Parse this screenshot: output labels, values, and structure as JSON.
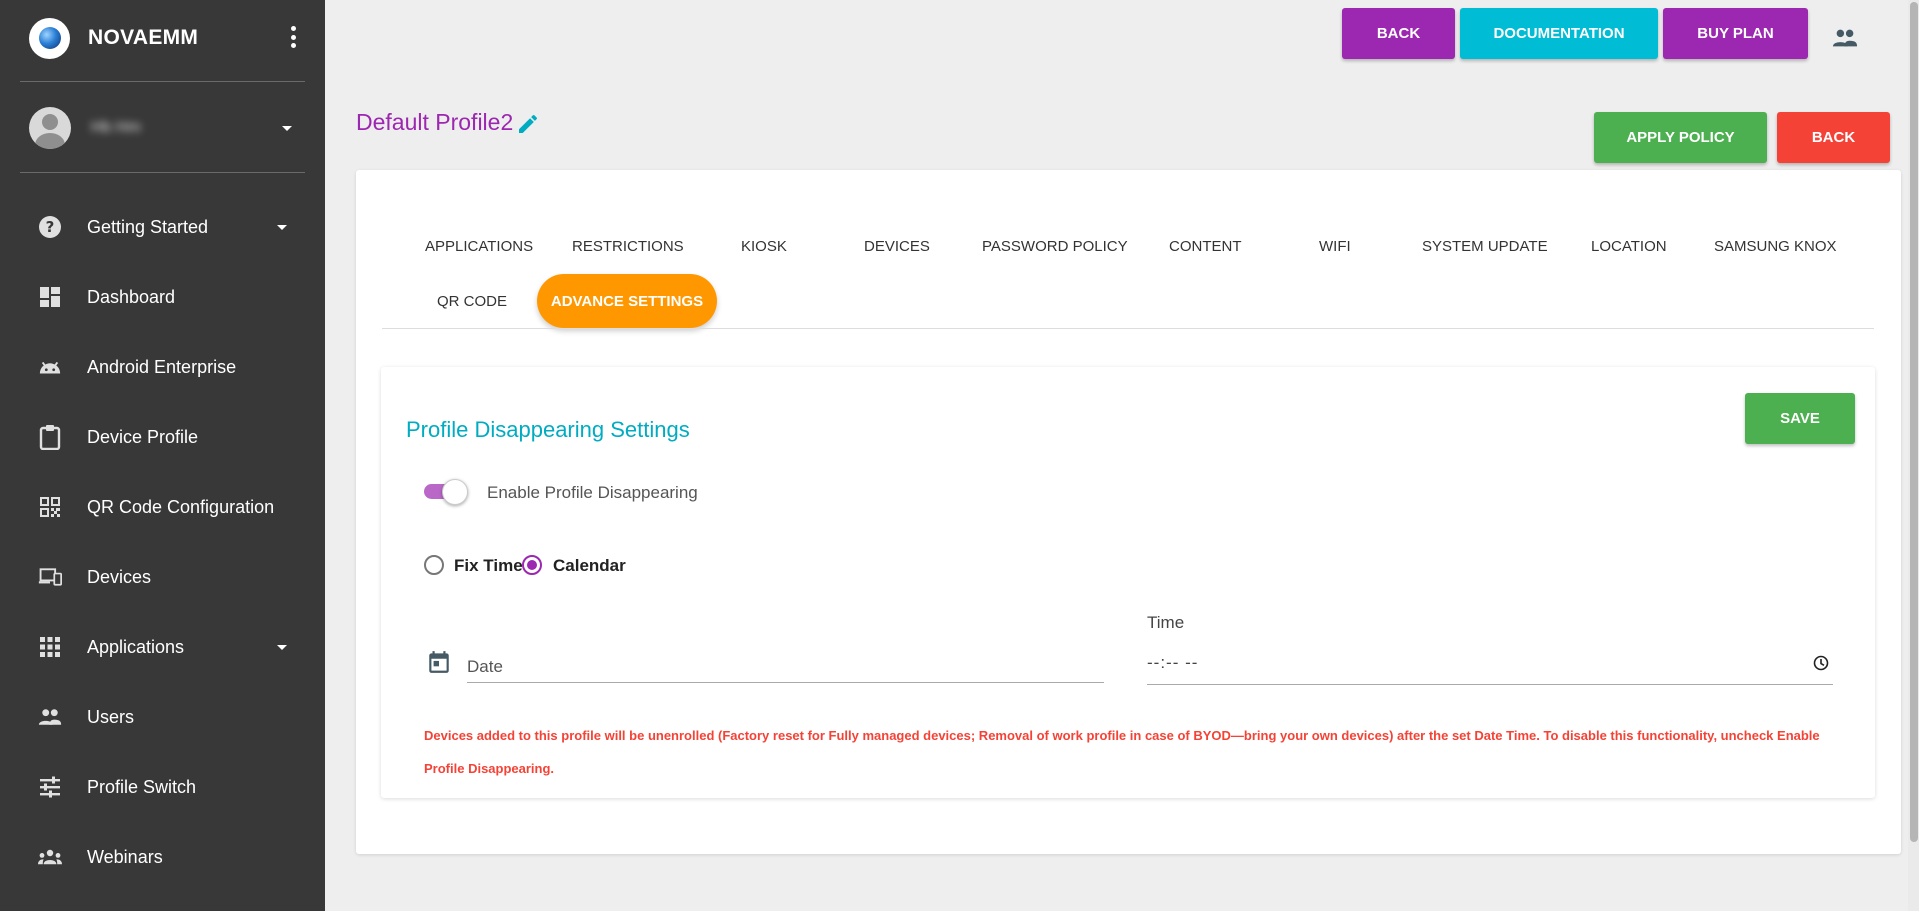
{
  "sidebar": {
    "brand": "NOVAEMM",
    "user_name": "Hb Hm",
    "items": [
      {
        "label": "Getting Started",
        "icon": "help-circle-icon",
        "has_caret": true
      },
      {
        "label": "Dashboard",
        "icon": "dashboard-icon",
        "has_caret": false
      },
      {
        "label": "Android Enterprise",
        "icon": "android-icon",
        "has_caret": false
      },
      {
        "label": "Device Profile",
        "icon": "clipboard-icon",
        "has_caret": false
      },
      {
        "label": "QR Code Configuration",
        "icon": "qr-code-icon",
        "has_caret": false
      },
      {
        "label": "Devices",
        "icon": "devices-icon",
        "has_caret": false
      },
      {
        "label": "Applications",
        "icon": "apps-grid-icon",
        "has_caret": true
      },
      {
        "label": "Users",
        "icon": "people-icon",
        "has_caret": false
      },
      {
        "label": "Profile Switch",
        "icon": "tune-icon",
        "has_caret": false
      },
      {
        "label": "Webinars",
        "icon": "groups-icon",
        "has_caret": false
      }
    ]
  },
  "header": {
    "back_label": "BACK",
    "documentation_label": "DOCUMENTATION",
    "buy_plan_label": "BUY PLAN"
  },
  "profile": {
    "title": "Default Profile2",
    "apply_policy_label": "APPLY POLICY",
    "back_label": "BACK"
  },
  "tabs": [
    "APPLICATIONS",
    "RESTRICTIONS",
    "KIOSK",
    "DEVICES",
    "PASSWORD POLICY",
    "CONTENT",
    "WIFI",
    "SYSTEM UPDATE",
    "LOCATION",
    "SAMSUNG KNOX",
    "QR CODE",
    "ADVANCE SETTINGS"
  ],
  "active_tab": "ADVANCE SETTINGS",
  "settings": {
    "section_title": "Profile Disappearing Settings",
    "save_label": "SAVE",
    "toggle_label": "Enable Profile Disappearing",
    "toggle_on": true,
    "radio_fix_time": "Fix Time",
    "radio_calendar": "Calendar",
    "selected_radio": "Calendar",
    "date_placeholder": "Date",
    "time_label": "Time",
    "time_value": "--:-- --",
    "warning": "Devices added to this profile will be unenrolled (Factory reset for Fully managed devices; Removal of work profile in case of BYOD—bring your own devices) after the set Date Time. To disable this functionality, uncheck Enable Profile Disappearing."
  },
  "colors": {
    "sidebar_bg": "#383838",
    "purple": "#9c27b0",
    "cyan": "#00bcd4",
    "green": "#4caf50",
    "red": "#f44336",
    "orange": "#ff9800"
  }
}
